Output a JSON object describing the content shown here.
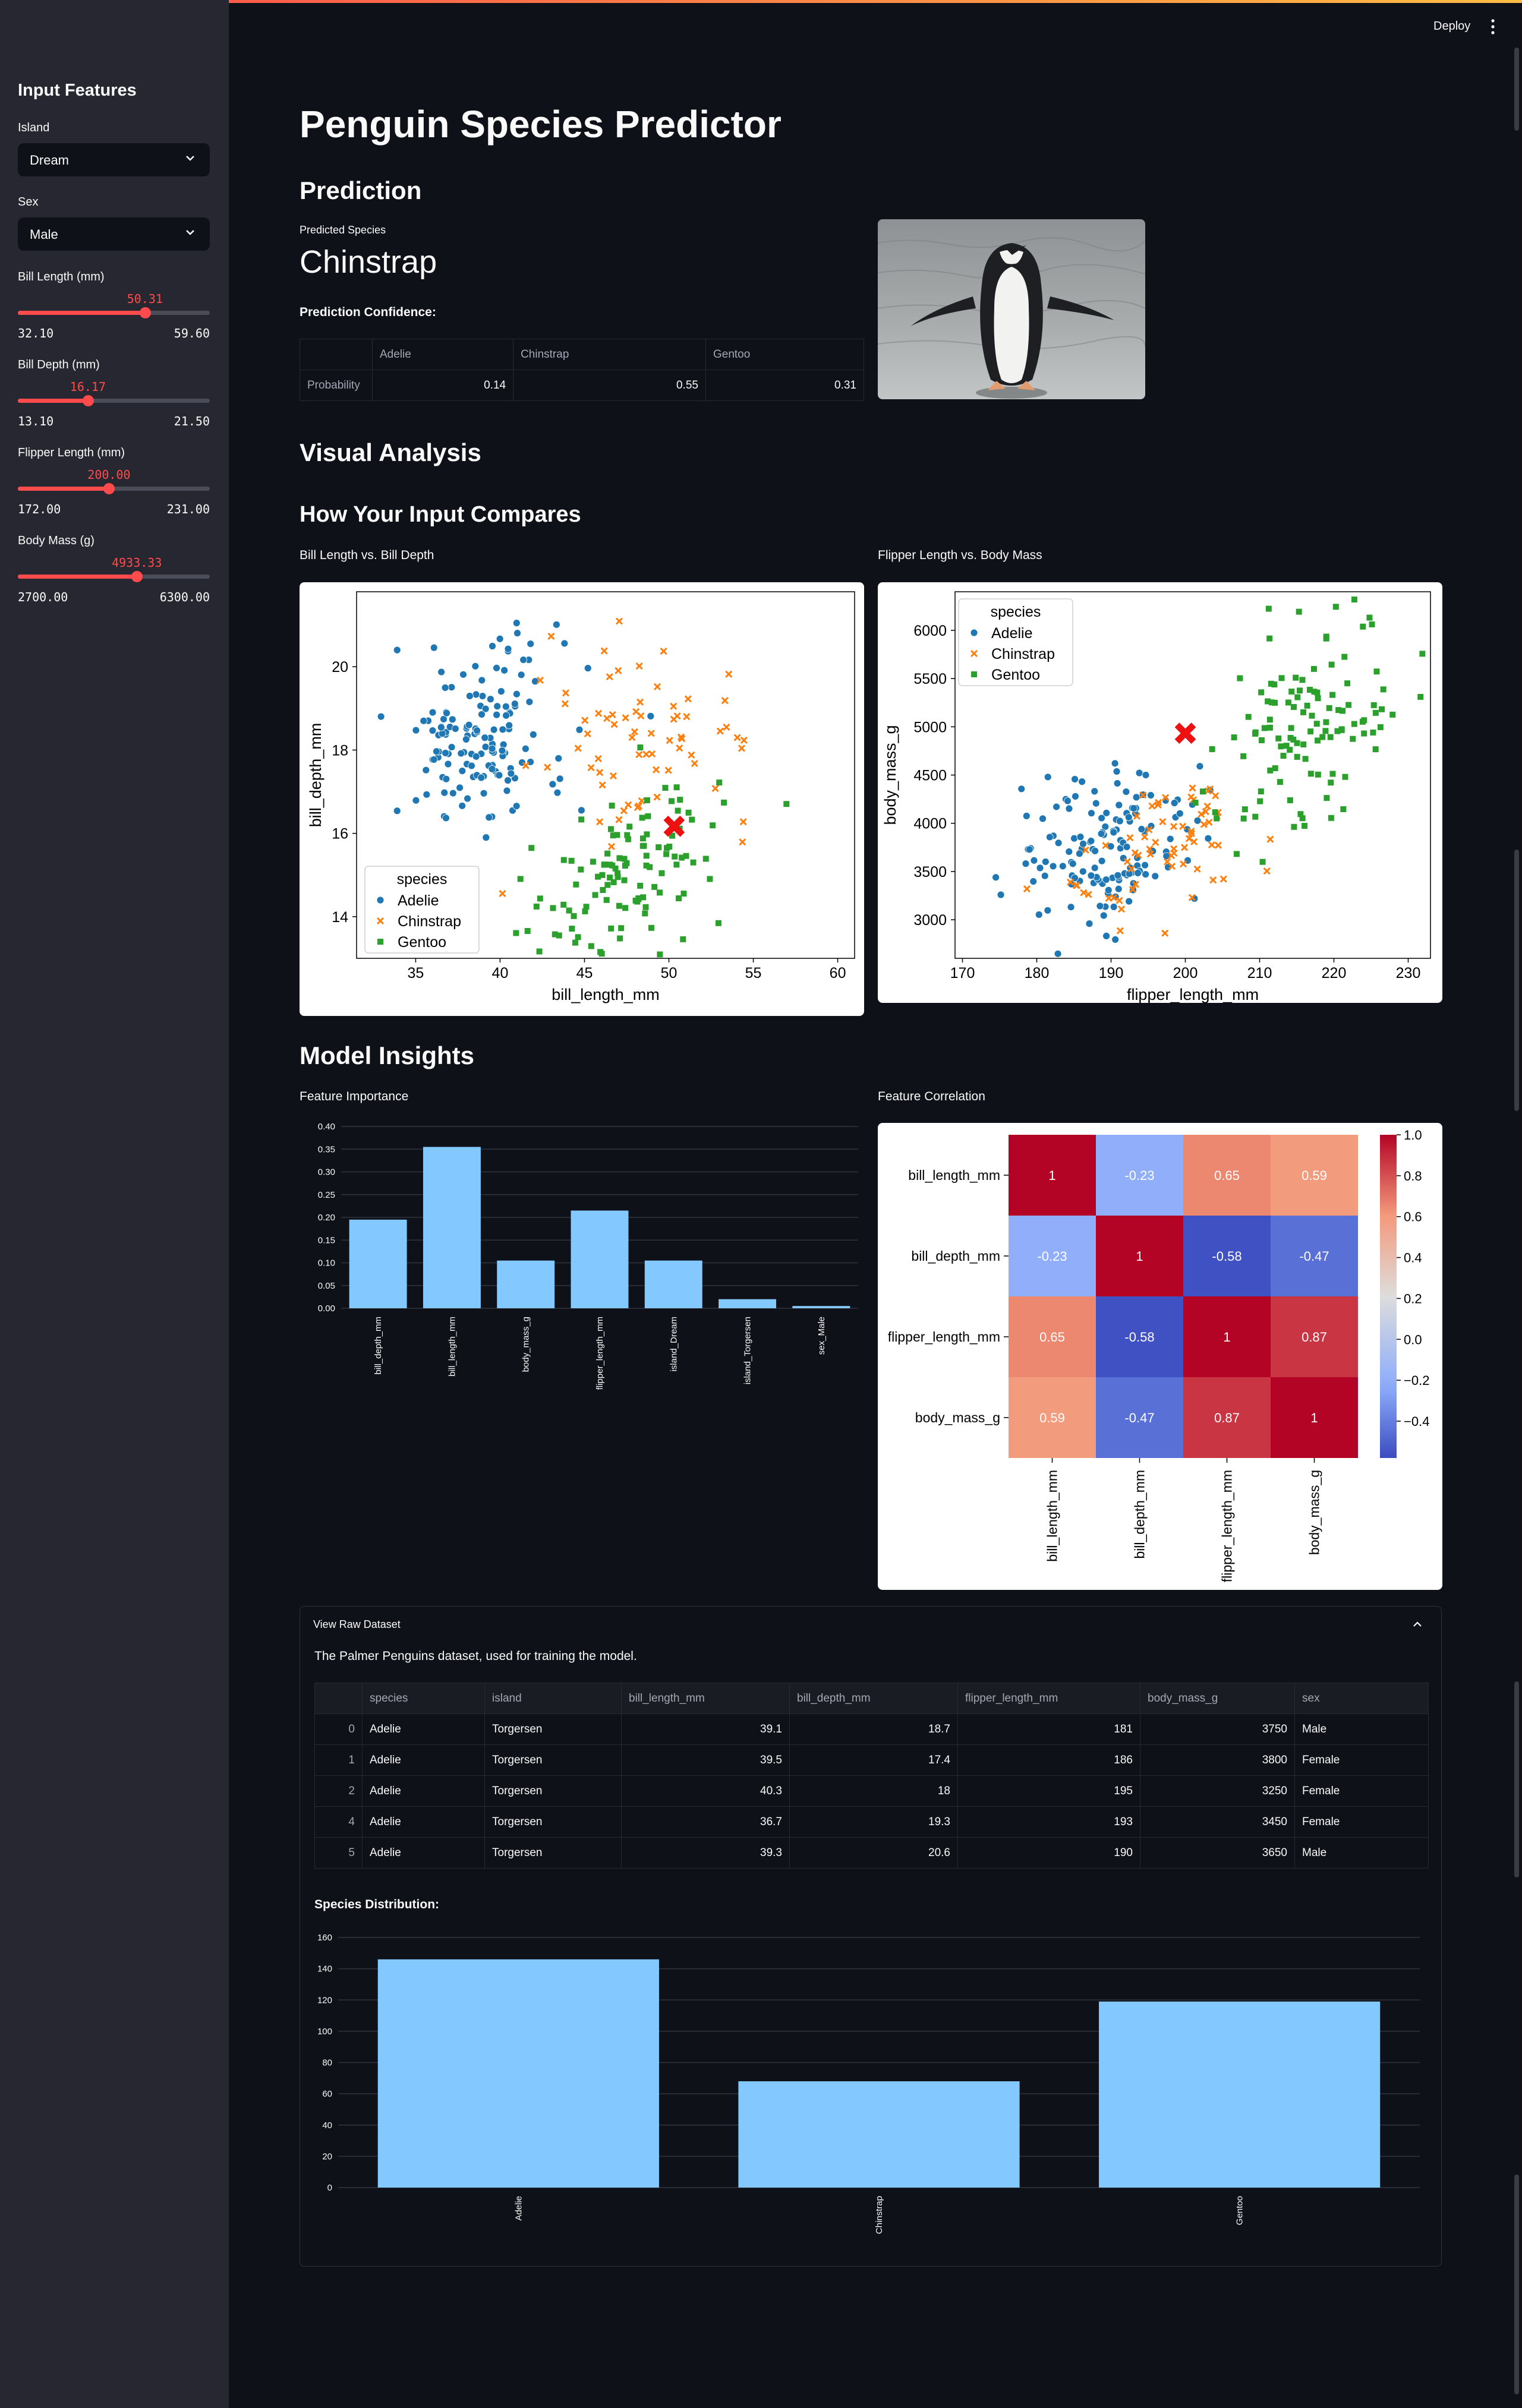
{
  "sidebar": {
    "title": "Input Features",
    "island": {
      "label": "Island",
      "value": "Dream"
    },
    "sex": {
      "label": "Sex",
      "value": "Male"
    },
    "sliders": [
      {
        "label": "Bill Length (mm)",
        "value": "50.31",
        "min": "32.10",
        "max": "59.60",
        "frac": 0.662
      },
      {
        "label": "Bill Depth (mm)",
        "value": "16.17",
        "min": "13.10",
        "max": "21.50",
        "frac": 0.365
      },
      {
        "label": "Flipper Length (mm)",
        "value": "200.00",
        "min": "172.00",
        "max": "231.00",
        "frac": 0.475
      },
      {
        "label": "Body Mass (g)",
        "value": "4933.33",
        "min": "2700.00",
        "max": "6300.00",
        "frac": 0.62
      }
    ]
  },
  "header": {
    "deploy": "Deploy"
  },
  "main": {
    "title": "Penguin Species Predictor",
    "prediction_heading": "Prediction",
    "predicted_label": "Predicted Species",
    "predicted_value": "Chinstrap",
    "confidence_label": "Prediction Confidence:",
    "confidence_table": {
      "columns": [
        "Adelie",
        "Chinstrap",
        "Gentoo"
      ],
      "row_label": "Probability",
      "values": [
        "0.14",
        "0.55",
        "0.31"
      ]
    },
    "visual_heading": "Visual Analysis",
    "compare_heading": "How Your Input Compares",
    "plot1_caption": "Bill Length vs. Bill Depth",
    "plot2_caption": "Flipper Length vs. Body Mass",
    "insights_heading": "Model Insights",
    "importance_caption": "Feature Importance",
    "correlation_caption": "Feature Correlation",
    "expander_title": "View Raw Dataset",
    "dataset_desc": "The Palmer Penguins dataset, used for training the model.",
    "raw_table": {
      "columns": [
        "",
        "species",
        "island",
        "bill_length_mm",
        "bill_depth_mm",
        "flipper_length_mm",
        "body_mass_g",
        "sex"
      ],
      "rows": [
        [
          "0",
          "Adelie",
          "Torgersen",
          "39.1",
          "18.7",
          "181",
          "3750",
          "Male"
        ],
        [
          "1",
          "Adelie",
          "Torgersen",
          "39.5",
          "17.4",
          "186",
          "3800",
          "Female"
        ],
        [
          "2",
          "Adelie",
          "Torgersen",
          "40.3",
          "18",
          "195",
          "3250",
          "Female"
        ],
        [
          "4",
          "Adelie",
          "Torgersen",
          "36.7",
          "19.3",
          "193",
          "3450",
          "Female"
        ],
        [
          "5",
          "Adelie",
          "Torgersen",
          "39.3",
          "20.6",
          "190",
          "3650",
          "Male"
        ]
      ]
    },
    "distribution_label": "Species Distribution:"
  },
  "colors": {
    "accent": "#ff4b4b",
    "bar": "#83c9ff",
    "adelie": "#1f77b4",
    "chinstrap": "#ff7f0e",
    "gentoo": "#2ca02c"
  },
  "chart_data": [
    {
      "type": "scatter",
      "title": "Bill Length vs. Bill Depth",
      "xlabel": "bill_length_mm",
      "ylabel": "bill_depth_mm",
      "xlim": [
        31.5,
        61
      ],
      "ylim": [
        13,
        21.8
      ],
      "xticks": [
        35,
        40,
        45,
        50,
        55,
        60
      ],
      "yticks": [
        14,
        16,
        18,
        20
      ],
      "legend_title": "species",
      "legend": [
        "Adelie",
        "Chinstrap",
        "Gentoo"
      ],
      "input_point": [
        50.31,
        16.17
      ]
    },
    {
      "type": "scatter",
      "title": "Flipper Length vs. Body Mass",
      "xlabel": "flipper_length_mm",
      "ylabel": "body_mass_g",
      "xlim": [
        169,
        233
      ],
      "ylim": [
        2600,
        6400
      ],
      "xticks": [
        170,
        180,
        190,
        200,
        210,
        220,
        230
      ],
      "yticks": [
        3000,
        3500,
        4000,
        4500,
        5000,
        5500,
        6000
      ],
      "legend_title": "species",
      "legend": [
        "Adelie",
        "Chinstrap",
        "Gentoo"
      ],
      "input_point": [
        200,
        4933.33
      ]
    },
    {
      "type": "bar",
      "title": "Feature Importance",
      "categories": [
        "bill_depth_mm",
        "bill_length_mm",
        "body_mass_g",
        "flipper_length_mm",
        "island_Dream",
        "island_Torgersen",
        "sex_Male"
      ],
      "values": [
        0.195,
        0.355,
        0.105,
        0.215,
        0.105,
        0.02,
        0.005
      ],
      "ylim": [
        0,
        0.4
      ],
      "yticks": [
        "0.00",
        "0.05",
        "0.10",
        "0.15",
        "0.20",
        "0.25",
        "0.30",
        "0.35",
        "0.40"
      ]
    },
    {
      "type": "heatmap",
      "title": "Feature Correlation",
      "labels": [
        "bill_length_mm",
        "bill_depth_mm",
        "flipper_length_mm",
        "body_mass_g"
      ],
      "matrix": [
        [
          1,
          -0.23,
          0.65,
          0.59
        ],
        [
          -0.23,
          1,
          -0.58,
          -0.47
        ],
        [
          0.65,
          -0.58,
          1,
          0.87
        ],
        [
          0.59,
          -0.47,
          0.87,
          1
        ]
      ],
      "colorbar_ticks": [
        "1.0",
        "0.8",
        "0.6",
        "0.4",
        "0.2",
        "0.0",
        "−0.2",
        "−0.4"
      ]
    },
    {
      "type": "bar",
      "title": "Species Distribution:",
      "categories": [
        "Adelie",
        "Chinstrap",
        "Gentoo"
      ],
      "values": [
        146,
        68,
        119
      ],
      "ylim": [
        0,
        160
      ],
      "yticks": [
        "0",
        "20",
        "40",
        "60",
        "80",
        "100",
        "120",
        "140",
        "160"
      ]
    }
  ]
}
